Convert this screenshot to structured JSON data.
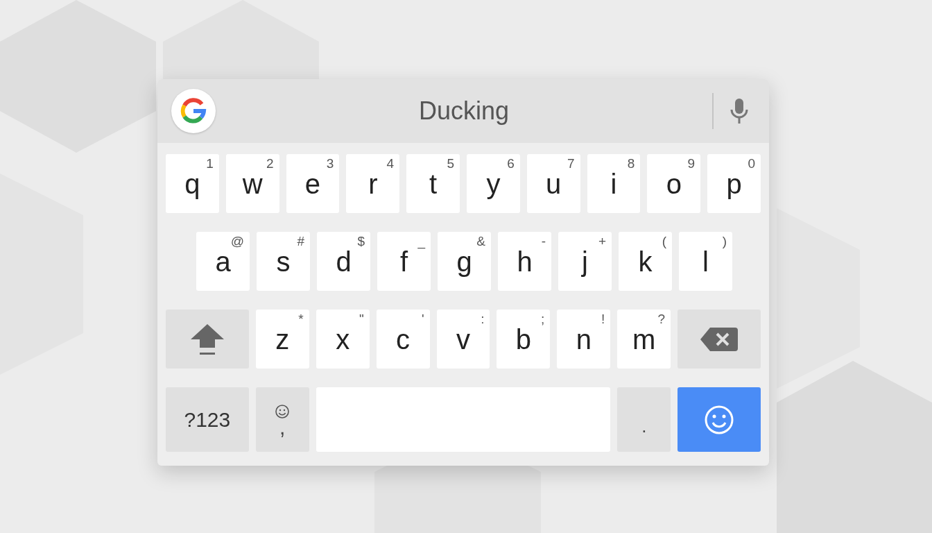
{
  "suggestion_bar": {
    "text": "Ducking"
  },
  "rows": [
    [
      {
        "kind": "letter",
        "label": "q",
        "hint": "1"
      },
      {
        "kind": "letter",
        "label": "w",
        "hint": "2"
      },
      {
        "kind": "letter",
        "label": "e",
        "hint": "3"
      },
      {
        "kind": "letter",
        "label": "r",
        "hint": "4"
      },
      {
        "kind": "letter",
        "label": "t",
        "hint": "5"
      },
      {
        "kind": "letter",
        "label": "y",
        "hint": "6"
      },
      {
        "kind": "letter",
        "label": "u",
        "hint": "7"
      },
      {
        "kind": "letter",
        "label": "i",
        "hint": "8"
      },
      {
        "kind": "letter",
        "label": "o",
        "hint": "9"
      },
      {
        "kind": "letter",
        "label": "p",
        "hint": "0"
      }
    ],
    [
      {
        "kind": "letter",
        "label": "a",
        "hint": "@"
      },
      {
        "kind": "letter",
        "label": "s",
        "hint": "#"
      },
      {
        "kind": "letter",
        "label": "d",
        "hint": "$"
      },
      {
        "kind": "letter",
        "label": "f",
        "hint": "_"
      },
      {
        "kind": "letter",
        "label": "g",
        "hint": "&"
      },
      {
        "kind": "letter",
        "label": "h",
        "hint": "-"
      },
      {
        "kind": "letter",
        "label": "j",
        "hint": "+"
      },
      {
        "kind": "letter",
        "label": "k",
        "hint": "("
      },
      {
        "kind": "letter",
        "label": "l",
        "hint": ")"
      }
    ],
    [
      {
        "kind": "shift"
      },
      {
        "kind": "letter",
        "label": "z",
        "hint": "*"
      },
      {
        "kind": "letter",
        "label": "x",
        "hint": "\""
      },
      {
        "kind": "letter",
        "label": "c",
        "hint": "'"
      },
      {
        "kind": "letter",
        "label": "v",
        "hint": ":"
      },
      {
        "kind": "letter",
        "label": "b",
        "hint": ";"
      },
      {
        "kind": "letter",
        "label": "n",
        "hint": "!"
      },
      {
        "kind": "letter",
        "label": "m",
        "hint": "?"
      },
      {
        "kind": "backspace"
      }
    ],
    [
      {
        "kind": "symbols",
        "label": "?123"
      },
      {
        "kind": "comma",
        "label": ","
      },
      {
        "kind": "space"
      },
      {
        "kind": "period",
        "label": "."
      },
      {
        "kind": "enter"
      }
    ]
  ]
}
